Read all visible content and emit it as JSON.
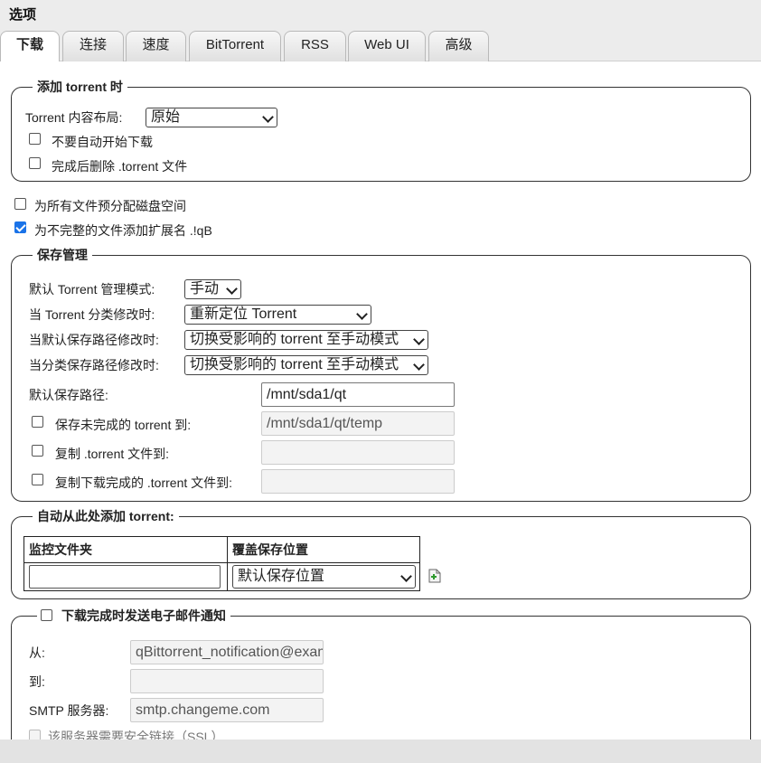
{
  "window": {
    "title": "选项"
  },
  "tabs": [
    "下载",
    "连接",
    "速度",
    "BitTorrent",
    "RSS",
    "Web UI",
    "高级"
  ],
  "add_torrent": {
    "legend": "添加 torrent 时",
    "layout_label": "Torrent 内容布局:",
    "layout_value": "原始",
    "dont_start_label": "不要自动开始下载",
    "dont_start_checked": false,
    "delete_after_label": "完成后删除 .torrent 文件",
    "delete_after_checked": false
  },
  "preallocate": {
    "label": "为所有文件预分配磁盘空间",
    "checked": false
  },
  "append_iqb": {
    "label": "为不完整的文件添加扩展名 .!qB",
    "checked": true
  },
  "save_mgmt": {
    "legend": "保存管理",
    "mode_label": "默认 Torrent 管理模式:",
    "mode_value": "手动",
    "category_changed_label": "当 Torrent 分类修改时:",
    "category_changed_value": "重新定位 Torrent",
    "default_path_changed_label": "当默认保存路径修改时:",
    "default_path_changed_value": "切换受影响的 torrent 至手动模式",
    "category_path_changed_label": "当分类保存路径修改时:",
    "category_path_changed_value": "切换受影响的 torrent 至手动模式",
    "default_path_label": "默认保存路径:",
    "default_path_value": "/mnt/sda1/qt",
    "incomplete_label": "保存未完成的 torrent 到:",
    "incomplete_value": "/mnt/sda1/qt/temp",
    "copy_torrent_label": "复制 .torrent 文件到:",
    "copy_torrent_value": "",
    "copy_finished_label": "复制下载完成的 .torrent 文件到:",
    "copy_finished_value": ""
  },
  "watch": {
    "legend": "自动从此处添加 torrent:",
    "col_folder": "监控文件夹",
    "col_override": "覆盖保存位置",
    "folder_value": "",
    "override_value": "默认保存位置"
  },
  "email": {
    "legend": "下载完成时发送电子邮件通知",
    "checked": false,
    "from_label": "从:",
    "from_value": "qBittorrent_notification@example.com",
    "to_label": "到:",
    "to_value": "",
    "smtp_label": "SMTP 服务器:",
    "smtp_value": "smtp.changeme.com",
    "ssl_label": "该服务器需要安全链接（SSL）"
  }
}
